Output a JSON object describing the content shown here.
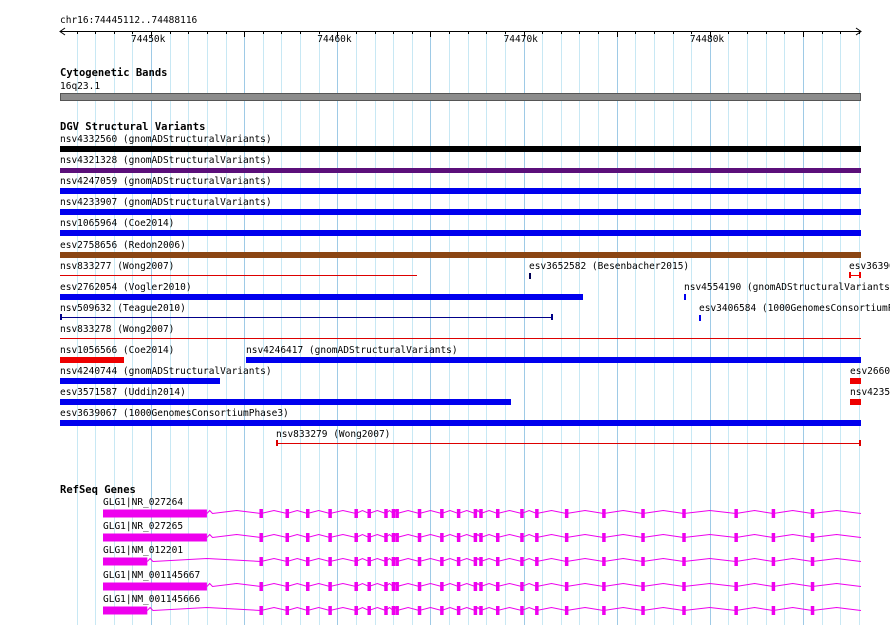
{
  "ruler": {
    "location": "chr16:74445112..74488116",
    "start": 74445112,
    "end": 74488116,
    "ticks": [
      {
        "pos": 74450000,
        "label": "74450k"
      },
      {
        "pos": 74460000,
        "label": "74460k"
      },
      {
        "pos": 74470000,
        "label": "74470k"
      },
      {
        "pos": 74480000,
        "label": "74480k"
      }
    ]
  },
  "cytoband": {
    "title": "Cytogenetic Bands",
    "band_label": "16q23.1",
    "color": "#8c8c8c"
  },
  "dgv": {
    "title": "DGV Structural Variants",
    "features": [
      {
        "label": "nsv4332560 (gnomADStructuralVariants)",
        "start": 74445112,
        "end": 74488116,
        "color": "#000000",
        "style": "thick",
        "row": 0
      },
      {
        "label": "nsv4321328 (gnomADStructuralVariants)",
        "start": 74445112,
        "end": 74488116,
        "color": "#5b0f7a",
        "style": "thin",
        "row": 1
      },
      {
        "label": "nsv4247059 (gnomADStructuralVariants)",
        "start": 74445112,
        "end": 74488116,
        "color": "#0000ee",
        "style": "thick",
        "row": 2
      },
      {
        "label": "nsv4233907 (gnomADStructuralVariants)",
        "start": 74445112,
        "end": 74488116,
        "color": "#0000ee",
        "style": "thick",
        "row": 3
      },
      {
        "label": "nsv1065964 (Coe2014)",
        "start": 74445112,
        "end": 74488116,
        "color": "#0000ee",
        "style": "thick",
        "row": 4
      },
      {
        "label": "esv2758656 (Redon2006)",
        "start": 74445112,
        "end": 74488116,
        "color": "#8b4513",
        "style": "thick",
        "row": 5
      },
      {
        "label": "nsv833277 (Wong2007)",
        "start": 74445112,
        "end": 74464300,
        "color": "#dd0000",
        "style": "line",
        "row": 6
      },
      {
        "label": "esv3652582 (Besenbacher2015)",
        "start": 74470300,
        "end": 74470450,
        "color": "#000055",
        "style": "tick",
        "row": 6
      },
      {
        "label": "esv36390",
        "start": 74487450,
        "end": 74488116,
        "color": "#ee0000",
        "style": "capline",
        "row": 6
      },
      {
        "label": "esv2762054 (Vogler2010)",
        "start": 74445112,
        "end": 74473200,
        "color": "#0000ee",
        "style": "thick",
        "row": 7
      },
      {
        "label": "nsv4554190 (gnomADStructuralVariants",
        "start": 74478600,
        "end": 74478750,
        "color": "#0000ee",
        "style": "tick",
        "row": 7
      },
      {
        "label": "nsv509632 (Teague2010)",
        "start": 74445112,
        "end": 74471600,
        "color": "#000088",
        "style": "capline",
        "row": 8
      },
      {
        "label": "esv3406584 (1000GenomesConsortiumP",
        "start": 74479400,
        "end": 74479550,
        "color": "#0000ee",
        "style": "tick",
        "row": 8
      },
      {
        "label": "nsv833278 (Wong2007)",
        "start": 74445112,
        "end": 74488116,
        "color": "#dd0000",
        "style": "line",
        "row": 9
      },
      {
        "label": "nsv1056566 (Coe2014)",
        "start": 74445112,
        "end": 74448550,
        "color": "#ee0000",
        "style": "thick",
        "row": 10
      },
      {
        "label": "nsv4246417 (gnomADStructuralVariants)",
        "start": 74455100,
        "end": 74488116,
        "color": "#0000ee",
        "style": "thick",
        "row": 10
      },
      {
        "label": "nsv4240744 (gnomADStructuralVariants)",
        "start": 74445112,
        "end": 74453700,
        "color": "#0000ee",
        "style": "thick",
        "row": 11
      },
      {
        "label": "esv2660",
        "start": 74487500,
        "end": 74488116,
        "color": "#ee0000",
        "style": "thick",
        "row": 11
      },
      {
        "label": "esv3571587 (Uddin2014)",
        "start": 74445112,
        "end": 74469300,
        "color": "#0000ee",
        "style": "thick",
        "row": 12
      },
      {
        "label": "nsv4235",
        "start": 74487500,
        "end": 74488116,
        "color": "#ee0000",
        "style": "thick",
        "row": 12
      },
      {
        "label": "esv3639067 (1000GenomesConsortiumPhase3)",
        "start": 74445112,
        "end": 74488116,
        "color": "#0000ee",
        "style": "thick",
        "row": 13
      },
      {
        "label": "nsv833279 (Wong2007)",
        "start": 74456700,
        "end": 74488116,
        "color": "#dd0000",
        "style": "capline",
        "row": 14
      }
    ]
  },
  "refseq": {
    "title": "RefSeq Genes",
    "color": "#ee00ee",
    "genes": [
      {
        "label": "GLG1|NR_027264",
        "utr_end": 74453000,
        "intron_start": 74453300
      },
      {
        "label": "GLG1|NR_027265",
        "utr_end": 74453000,
        "intron_start": 74453300
      },
      {
        "label": "GLG1|NM_012201",
        "utr_end": 74449800,
        "intron_start": 74450100
      },
      {
        "label": "GLG1|NM_001145667",
        "utr_end": 74453000,
        "intron_start": 74453300
      },
      {
        "label": "GLG1|NM_001145666",
        "utr_end": 74449800,
        "intron_start": 74450100
      }
    ],
    "exons": [
      74455900,
      74457300,
      74458400,
      74459600,
      74461000,
      74461700,
      74462600,
      74463000,
      74463200,
      74464400,
      74465600,
      74466500,
      74467400,
      74467700,
      74468600,
      74469900,
      74470700,
      74472300,
      74474300,
      74476400,
      74478600,
      74481400,
      74483400,
      74485500
    ]
  }
}
